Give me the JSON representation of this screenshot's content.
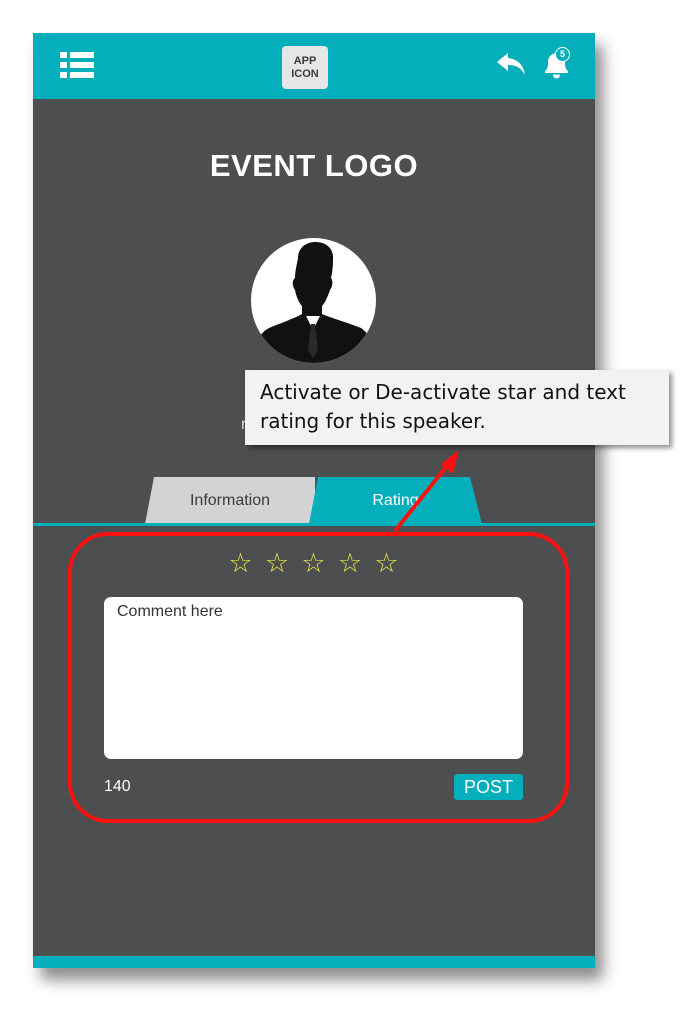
{
  "header": {
    "app_icon_line1": "APP",
    "app_icon_line2": "ICON",
    "notification_count": "5",
    "icons": [
      "list-menu-icon",
      "back-arrow-icon",
      "bell-icon"
    ]
  },
  "event_logo": "EVENT LOGO",
  "speaker": {
    "name_visible_fragment": "r"
  },
  "tabs": [
    {
      "label": "Information",
      "active": false
    },
    {
      "label": "Rating",
      "active": true
    }
  ],
  "rating": {
    "stars": [
      "☆",
      "☆",
      "☆",
      "☆",
      "☆"
    ],
    "comment_placeholder": "Comment here",
    "char_counter": "140",
    "post_label": "POST"
  },
  "annotation": {
    "callout_text": "Activate or De-activate star and text rating for this speaker."
  },
  "colors": {
    "accent": "#05aebb",
    "background": "#4d4e50",
    "highlight": "#ff1010",
    "star": "#e8e34b"
  }
}
